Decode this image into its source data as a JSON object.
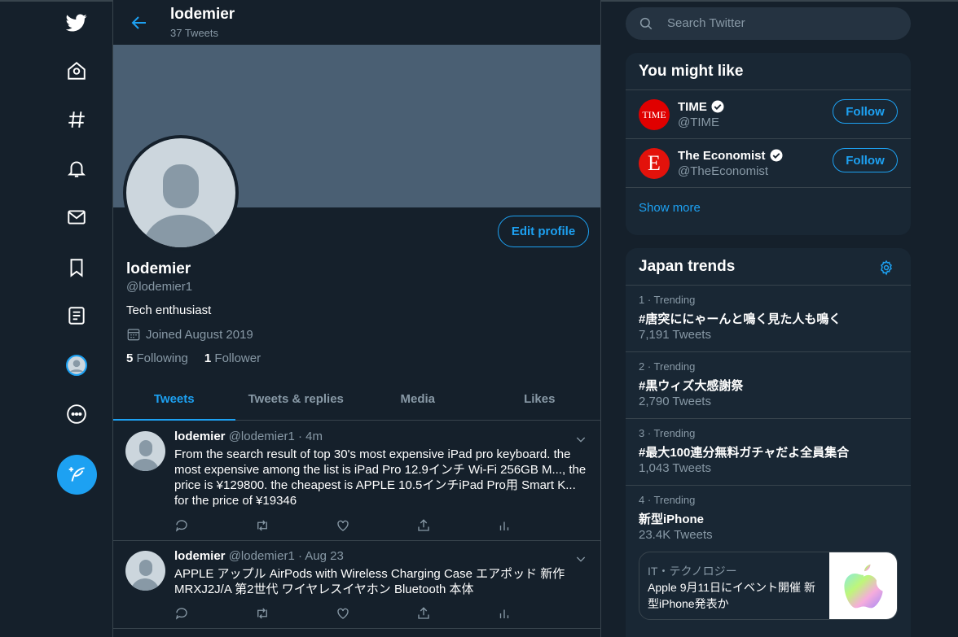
{
  "profile": {
    "name": "lodemier",
    "tweet_count": "37 Tweets",
    "handle": "@lodemier1",
    "bio": "Tech enthusiast",
    "joined": "Joined August 2019",
    "following_count": "5",
    "following_label": "Following",
    "followers_count": "1",
    "followers_label": "Follower",
    "edit_label": "Edit profile"
  },
  "tabs": [
    "Tweets",
    "Tweets & replies",
    "Media",
    "Likes"
  ],
  "tweets": [
    {
      "name": "lodemier",
      "meta": "@lodemier1 · 4m",
      "text": "From the search result of top 30's most expensive iPad pro keyboard. the most expensive among the list is  iPad Pro 12.9インチ Wi-Fi 256GB M..., the price is ¥129800. the cheapest is APPLE 10.5インチiPad Pro用 Smart K... for the price of ¥19346"
    },
    {
      "name": "lodemier",
      "meta": "@lodemier1 · Aug 23",
      "text": "APPLE アップル AirPods with Wireless Charging Case エアポッド 新作 MRXJ2J/A 第2世代 ワイヤレスイヤホン Bluetooth 本体"
    }
  ],
  "search": {
    "placeholder": "Search Twitter"
  },
  "who_to_follow": {
    "title": "You might like",
    "accounts": [
      {
        "name": "TIME",
        "handle": "@TIME",
        "button": "Follow",
        "logo_text": "TIME",
        "logo_color": "#e00000"
      },
      {
        "name": "The Economist",
        "handle": "@TheEconomist",
        "button": "Follow",
        "logo_text": "E",
        "logo_color": "#e3120b"
      }
    ],
    "show_more": "Show more"
  },
  "trends": {
    "title": "Japan trends",
    "items": [
      {
        "meta": "1 · Trending",
        "title": "#唐突ににゃーんと鳴く見た人も鳴く",
        "count": "7,191 Tweets"
      },
      {
        "meta": "2 · Trending",
        "title": "#黒ウィズ大感謝祭",
        "count": "2,790 Tweets"
      },
      {
        "meta": "3 · Trending",
        "title": "#最大100連分無料ガチャだよ全員集合",
        "count": "1,043 Tweets"
      },
      {
        "meta": "4 · Trending",
        "title": "新型iPhone",
        "count": "23.4K Tweets"
      }
    ],
    "news": {
      "category": "IT・テクノロジー",
      "headline": "Apple 9月11日にイベント開催 新型iPhone発表か"
    }
  },
  "colors": {
    "accent": "#1da1f2",
    "background": "#15202b",
    "panel": "#192734",
    "muted": "#8899a6",
    "border": "#38444d"
  }
}
